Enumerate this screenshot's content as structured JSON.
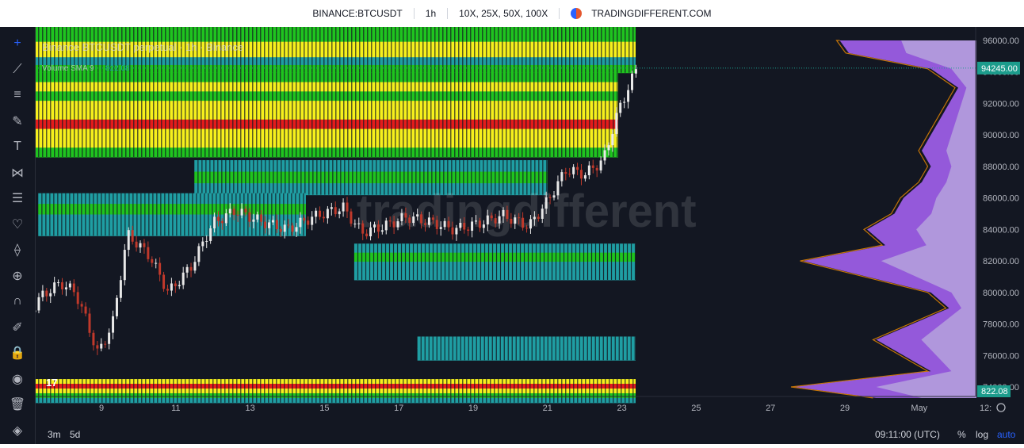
{
  "header": {
    "symbol": "BINANCE:BTCUSDT",
    "interval": "1h",
    "leverages": "10X, 25X, 50X, 100X",
    "brand": "TRADINGDIFFERENT.COM"
  },
  "toolbar": {
    "tools": [
      "crosshair-icon",
      "trendline-icon",
      "fib-icon",
      "brush-icon",
      "text-icon",
      "pattern-icon",
      "forecast-icon",
      "heart-icon",
      "ruler-icon",
      "zoom-icon",
      "magnet-icon",
      "lock-draw-icon",
      "lock-icon",
      "eye-icon",
      "trash-icon",
      "layers-icon"
    ]
  },
  "legend": {
    "title": "Binance BTCUSDT perpetual · 1h · Binance",
    "volume_label": "Volume SMA 9",
    "volume_value": "822.08"
  },
  "watermark": {
    "text": "tradingdifferent"
  },
  "bottombar": {
    "ranges": [
      "3m",
      "5d"
    ],
    "time": "09:11:00 (UTC)",
    "percent": "%",
    "log": "log",
    "auto": "auto"
  },
  "colors": {
    "background": "#131722",
    "yellow": "#f6f01c",
    "green": "#1fc41f",
    "teal": "#1f9ea3",
    "red": "#e51b1b",
    "candle": "#c0392b",
    "profile_violet": "#9b5de5",
    "profile_lavender": "#b39ddb",
    "profile_orange": "#f08c00",
    "price_label": "#1c9c8c"
  },
  "chart_data": {
    "type": "candlestick",
    "title": "Binance BTCUSDT perpetual · 1h · Binance",
    "y_axis": {
      "ticks": [
        "96000.00",
        "94000.00",
        "92000.00",
        "90000.00",
        "88000.00",
        "86000.00",
        "84000.00",
        "82000.00",
        "80000.00",
        "78000.00",
        "76000.00",
        "74000.00"
      ],
      "ylim": [
        73000,
        97000
      ]
    },
    "x_axis": {
      "ticks": [
        "9",
        "11",
        "13",
        "15",
        "17",
        "19",
        "21",
        "23",
        "25",
        "27",
        "29",
        "May",
        "12:"
      ]
    },
    "current_price": "94245.00",
    "volume_sma": "822.08",
    "price_path": [
      {
        "day": 7.0,
        "price": 78500
      },
      {
        "day": 7.4,
        "price": 79800
      },
      {
        "day": 7.9,
        "price": 80600
      },
      {
        "day": 8.3,
        "price": 80000
      },
      {
        "day": 8.6,
        "price": 78200
      },
      {
        "day": 8.9,
        "price": 76100
      },
      {
        "day": 9.3,
        "price": 78000
      },
      {
        "day": 9.7,
        "price": 83700
      },
      {
        "day": 10.3,
        "price": 82300
      },
      {
        "day": 10.8,
        "price": 80000
      },
      {
        "day": 11.4,
        "price": 81600
      },
      {
        "day": 12.0,
        "price": 84400
      },
      {
        "day": 12.6,
        "price": 85200
      },
      {
        "day": 13.3,
        "price": 84500
      },
      {
        "day": 14.0,
        "price": 84000
      },
      {
        "day": 14.7,
        "price": 84800
      },
      {
        "day": 15.5,
        "price": 85400
      },
      {
        "day": 16.0,
        "price": 83800
      },
      {
        "day": 16.6,
        "price": 84200
      },
      {
        "day": 17.2,
        "price": 84800
      },
      {
        "day": 17.8,
        "price": 84500
      },
      {
        "day": 18.5,
        "price": 84000
      },
      {
        "day": 19.2,
        "price": 84400
      },
      {
        "day": 19.8,
        "price": 84900
      },
      {
        "day": 20.5,
        "price": 84200
      },
      {
        "day": 21.0,
        "price": 85800
      },
      {
        "day": 21.5,
        "price": 87800
      },
      {
        "day": 22.0,
        "price": 87500
      },
      {
        "day": 22.5,
        "price": 88400
      },
      {
        "day": 22.9,
        "price": 91500
      },
      {
        "day": 23.4,
        "price": 94245
      }
    ],
    "liquidation_bands": [
      {
        "from": 93950,
        "to": 96900,
        "start_day": 7.0,
        "end_day": 23.5,
        "levels": [
          "green",
          "green",
          "yellow",
          "yellow",
          "teal",
          "green"
        ]
      },
      {
        "from": 88600,
        "to": 93950,
        "start_day": 7.0,
        "end_day": 22.9,
        "levels": [
          "green",
          "yellow",
          "green",
          "yellow",
          "yellow",
          "red",
          "yellow",
          "yellow",
          "green"
        ]
      },
      {
        "from": 86200,
        "to": 88400,
        "start_day": 11.5,
        "end_day": 21.0,
        "levels": [
          "teal",
          "green",
          "teal"
        ]
      },
      {
        "from": 83600,
        "to": 86300,
        "start_day": 7.3,
        "end_day": 14.5,
        "levels": [
          "teal",
          "green",
          "teal",
          "teal"
        ]
      },
      {
        "from": 80800,
        "to": 83100,
        "start_day": 15.8,
        "end_day": 23.5,
        "levels": [
          "teal",
          "green",
          "teal",
          "teal"
        ]
      },
      {
        "from": 75700,
        "to": 77200,
        "start_day": 17.5,
        "end_day": 23.5,
        "levels": [
          "teal",
          "teal"
        ]
      },
      {
        "from": 73000,
        "to": 74500,
        "start_day": 7.0,
        "end_day": 23.5,
        "levels": [
          "yellow",
          "red",
          "yellow",
          "green",
          "teal"
        ]
      }
    ],
    "volume_profile": [
      {
        "price": 96000,
        "value": 0.75
      },
      {
        "price": 95200,
        "value": 0.7
      },
      {
        "price": 94200,
        "value": 0.25
      },
      {
        "price": 93000,
        "value": 0.1
      },
      {
        "price": 92000,
        "value": 0.15
      },
      {
        "price": 91000,
        "value": 0.2
      },
      {
        "price": 90000,
        "value": 0.25
      },
      {
        "price": 89000,
        "value": 0.3
      },
      {
        "price": 88000,
        "value": 0.25
      },
      {
        "price": 87000,
        "value": 0.3
      },
      {
        "price": 86000,
        "value": 0.4
      },
      {
        "price": 85000,
        "value": 0.45
      },
      {
        "price": 84000,
        "value": 0.6
      },
      {
        "price": 83000,
        "value": 0.5
      },
      {
        "price": 82000,
        "value": 0.95
      },
      {
        "price": 81000,
        "value": 0.6
      },
      {
        "price": 80000,
        "value": 0.25
      },
      {
        "price": 79000,
        "value": 0.15
      },
      {
        "price": 78000,
        "value": 0.35
      },
      {
        "price": 77000,
        "value": 0.55
      },
      {
        "price": 76000,
        "value": 0.4
      },
      {
        "price": 75000,
        "value": 0.25
      },
      {
        "price": 74000,
        "value": 1.0
      },
      {
        "price": 73300,
        "value": 0.55
      }
    ]
  }
}
